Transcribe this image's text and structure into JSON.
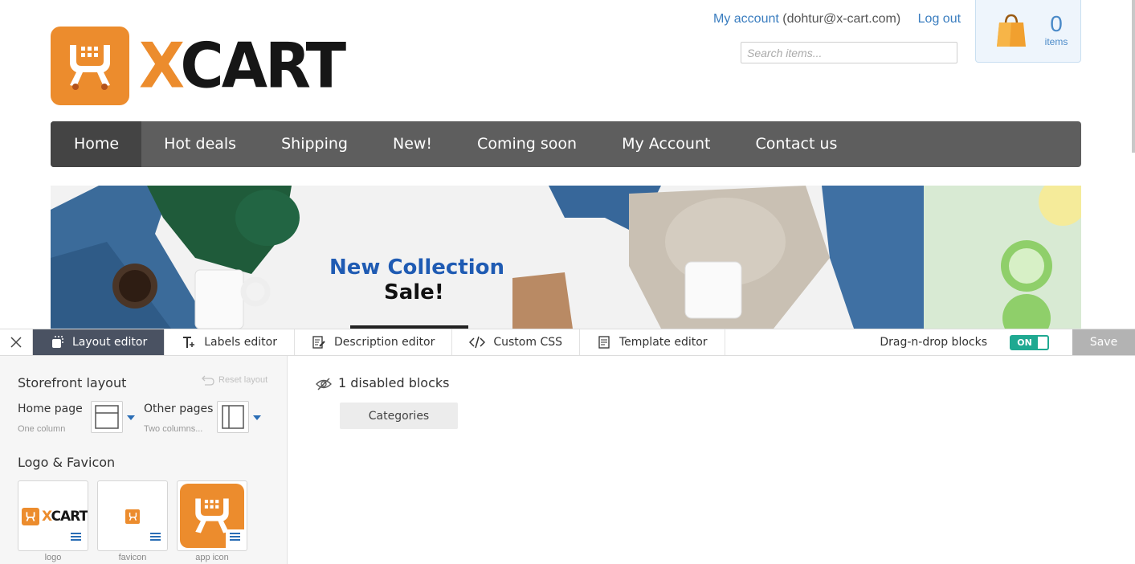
{
  "store": {
    "logo_text_x": "X",
    "logo_text_rest": "CART",
    "my_account_label": "My account",
    "account_email": "(dohtur@x-cart.com)",
    "logout_label": "Log out",
    "search_placeholder": "Search items...",
    "cart_count": "0",
    "cart_items_label": "items"
  },
  "nav": [
    {
      "label": "Home",
      "active": true
    },
    {
      "label": "Hot deals"
    },
    {
      "label": "Shipping"
    },
    {
      "label": "New!"
    },
    {
      "label": "Coming soon"
    },
    {
      "label": "My Account"
    },
    {
      "label": "Contact us"
    }
  ],
  "banner": {
    "title": "New Collection",
    "subtitle": "Sale!"
  },
  "toolbar": {
    "tabs": [
      {
        "label": "Layout editor",
        "icon": "layout-icon",
        "active": true
      },
      {
        "label": "Labels editor",
        "icon": "text-icon"
      },
      {
        "label": "Description editor",
        "icon": "edit-doc-icon"
      },
      {
        "label": "Custom CSS",
        "icon": "code-icon"
      },
      {
        "label": "Template editor",
        "icon": "template-icon"
      }
    ],
    "dnd_label": "Drag-n-drop blocks",
    "toggle_label": "ON",
    "save_label": "Save"
  },
  "panel": {
    "storefront_title": "Storefront layout",
    "reset_label": "Reset layout",
    "home_label": "Home page",
    "home_sub": "One column",
    "other_label": "Other pages",
    "other_sub": "Two columns...",
    "logo_title": "Logo & Favicon",
    "thumbs": [
      {
        "caption": "logo"
      },
      {
        "caption": "favicon"
      },
      {
        "caption": "app icon"
      }
    ]
  },
  "disabled": {
    "title": "1 disabled blocks",
    "blocks": [
      "Categories"
    ]
  },
  "colors": {
    "brand_orange": "#ec8c2d",
    "nav_bg": "#5e5e5e",
    "toggle_green": "#1fa991",
    "link_blue": "#3a7dbf"
  }
}
